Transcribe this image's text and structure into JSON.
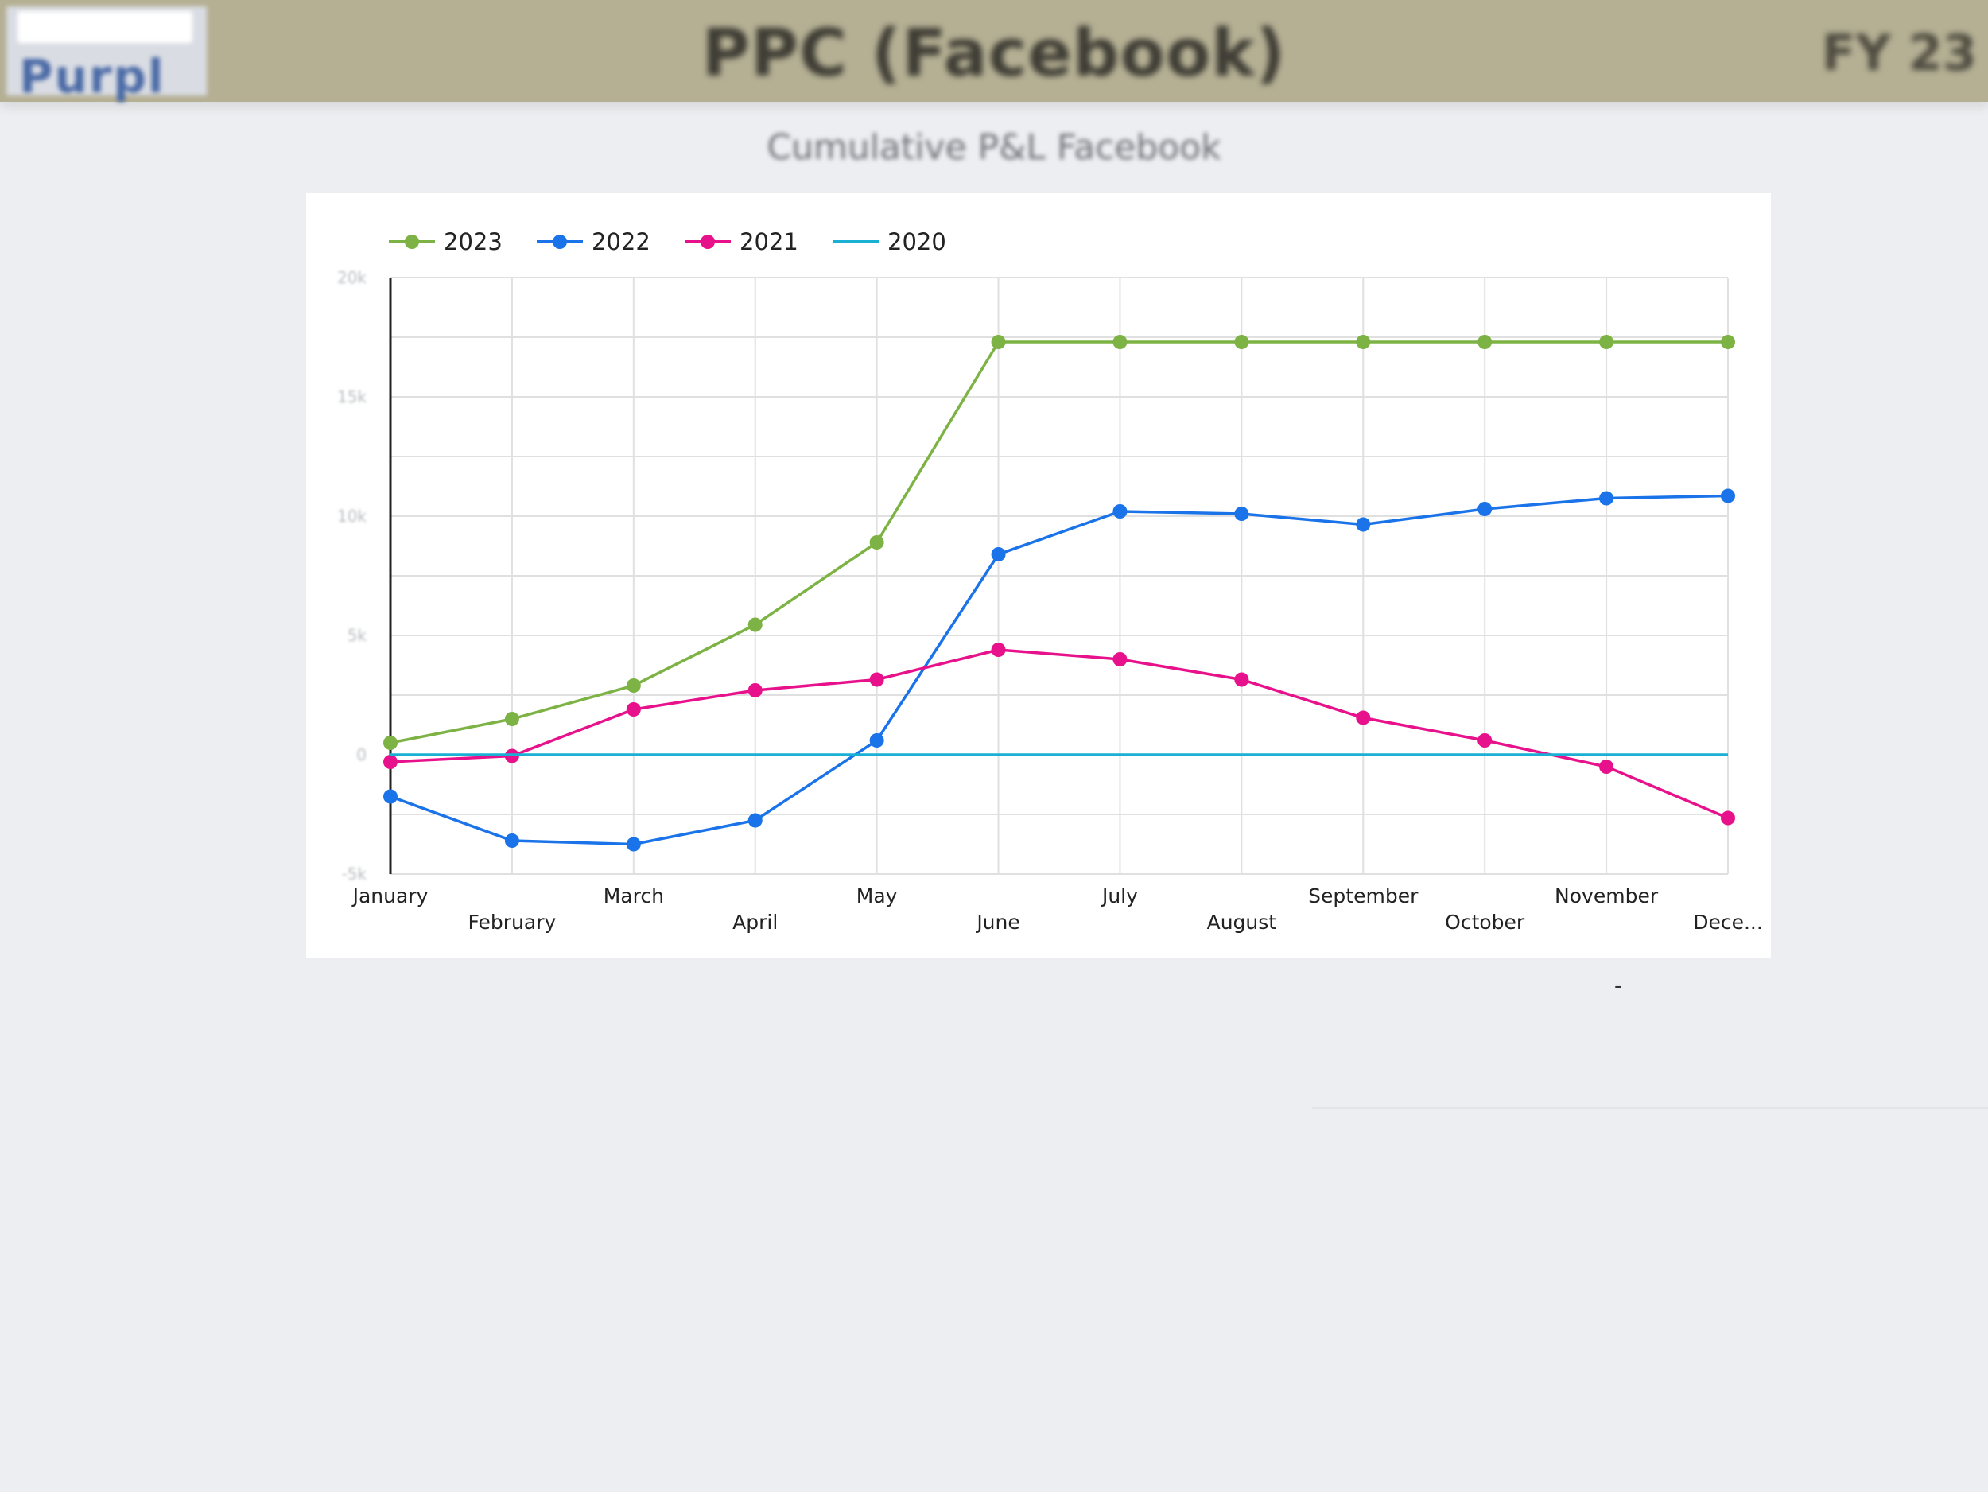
{
  "header": {
    "logo_text": "Purpl",
    "title": "PPC (Facebook)",
    "right_text": "FY 23"
  },
  "chart_caption": "Cumulative P&L Facebook",
  "footer_mark": "-",
  "colors": {
    "2023": "#7db344",
    "2022": "#1a73e8",
    "2021": "#e8118c",
    "2020": "#1ab0d4",
    "grid": "#e0e0e0",
    "axis": "#222222"
  },
  "chart_data": {
    "type": "line",
    "title": "",
    "xlabel": "",
    "ylabel": "",
    "categories": [
      "January",
      "February",
      "March",
      "April",
      "May",
      "June",
      "July",
      "August",
      "September",
      "October",
      "November",
      "Dece..."
    ],
    "ylim": [
      -10,
      40
    ],
    "y_ticks": [
      -10,
      0,
      10,
      20,
      30,
      40
    ],
    "y_tick_labels": [
      "-5k",
      "0",
      "5k",
      "10k",
      "15k",
      "20k"
    ],
    "grid": true,
    "legend_position": "top-left",
    "series": [
      {
        "name": "2023",
        "markers": true,
        "values": [
          1,
          3,
          5.8,
          10.9,
          17.8,
          34.6,
          34.6,
          34.6,
          34.6,
          34.6,
          34.6,
          34.6
        ]
      },
      {
        "name": "2022",
        "markers": true,
        "values": [
          -3.5,
          -7.2,
          -7.5,
          -5.5,
          1.2,
          16.8,
          20.4,
          20.2,
          19.3,
          20.6,
          21.5,
          21.7
        ]
      },
      {
        "name": "2021",
        "markers": true,
        "values": [
          -0.6,
          -0.1,
          3.8,
          5.4,
          6.3,
          8.8,
          8,
          6.3,
          3.1,
          1.2,
          -1,
          -5.3
        ]
      },
      {
        "name": "2020",
        "markers": false,
        "values": [
          0,
          0,
          0,
          0,
          0,
          0,
          0,
          0,
          0,
          0,
          0,
          0
        ]
      }
    ]
  }
}
